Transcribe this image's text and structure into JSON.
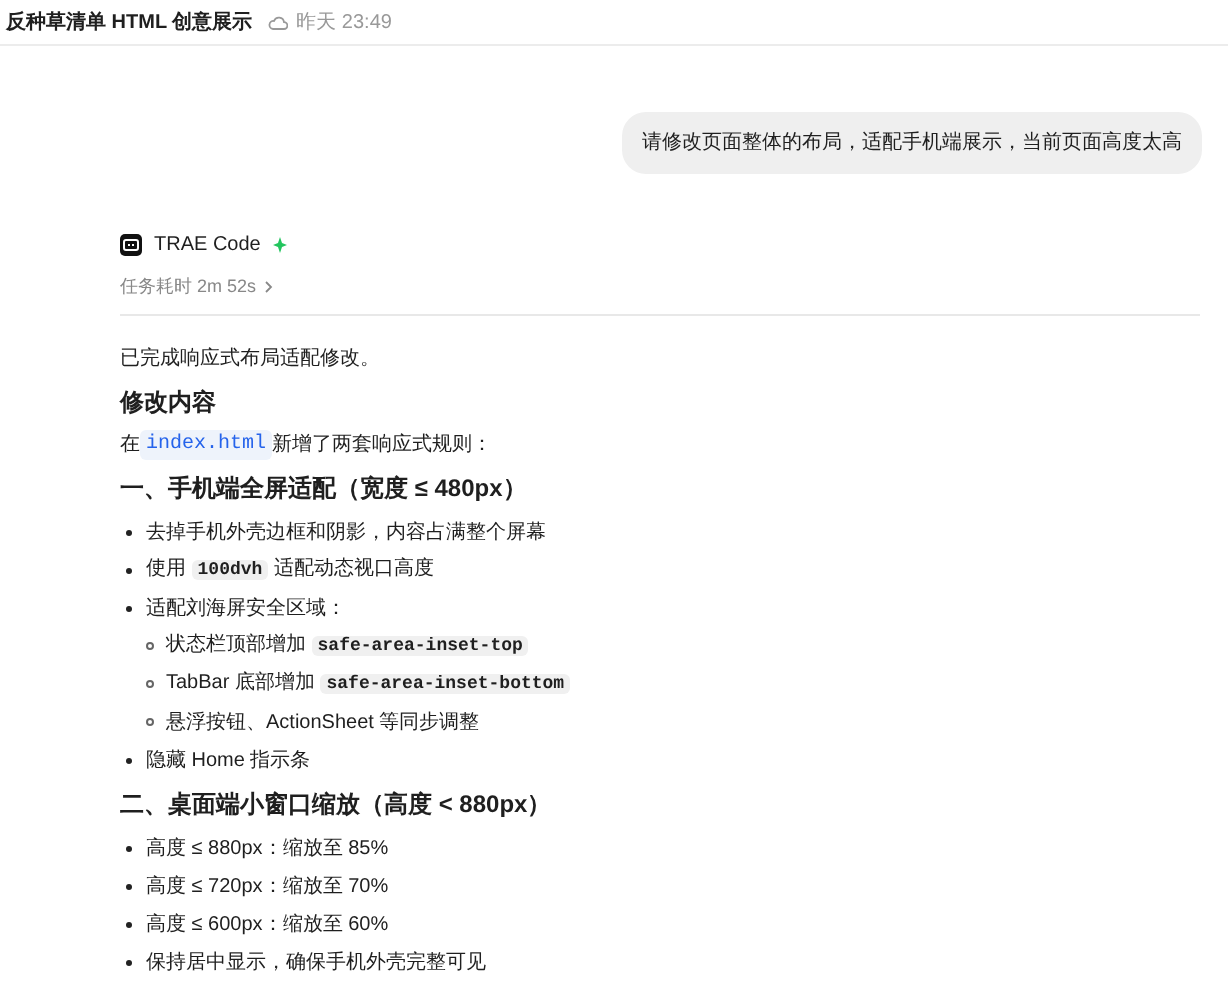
{
  "header": {
    "title": "反种草清单 HTML 创意展示",
    "time": "昨天 23:49"
  },
  "user_message": "请修改页面整体的布局，适配手机端展示，当前页面高度太高",
  "assistant": {
    "name": "TRAE Code",
    "duration": "任务耗时 2m 52s"
  },
  "content": [
    {
      "kind": "paragraph",
      "segments": [
        {
          "kind": "text",
          "text": "已完成响应式布局适配修改。"
        }
      ]
    },
    {
      "kind": "heading",
      "segments": [
        {
          "kind": "text",
          "text": "修改内容"
        }
      ]
    },
    {
      "kind": "paragraph",
      "segments": [
        {
          "kind": "text",
          "text": "在 "
        },
        {
          "kind": "file",
          "text": "index.html"
        },
        {
          "kind": "text",
          "text": " 新增了两套响应式规则："
        }
      ]
    },
    {
      "kind": "heading",
      "segments": [
        {
          "kind": "text",
          "text": "一、手机端全屏适配（宽度 ≤ 480px）"
        }
      ]
    },
    {
      "kind": "list",
      "items": [
        {
          "segments": [
            {
              "kind": "text",
              "text": "去掉手机外壳边框和阴影，内容占满整个屏幕"
            }
          ]
        },
        {
          "segments": [
            {
              "kind": "text",
              "text": "使用 "
            },
            {
              "kind": "code",
              "text": "100dvh"
            },
            {
              "kind": "text",
              "text": " 适配动态视口高度"
            }
          ]
        },
        {
          "segments": [
            {
              "kind": "text",
              "text": "适配刘海屏安全区域："
            }
          ],
          "children": [
            {
              "segments": [
                {
                  "kind": "text",
                  "text": "状态栏顶部增加 "
                },
                {
                  "kind": "code",
                  "text": "safe-area-inset-top"
                }
              ]
            },
            {
              "segments": [
                {
                  "kind": "text",
                  "text": "TabBar 底部增加 "
                },
                {
                  "kind": "code",
                  "text": "safe-area-inset-bottom"
                }
              ]
            },
            {
              "segments": [
                {
                  "kind": "text",
                  "text": "悬浮按钮、ActionSheet 等同步调整"
                }
              ]
            }
          ]
        },
        {
          "segments": [
            {
              "kind": "text",
              "text": "隐藏 Home 指示条"
            }
          ]
        }
      ]
    },
    {
      "kind": "heading",
      "segments": [
        {
          "kind": "text",
          "text": "二、桌面端小窗口缩放（高度 < 880px）"
        }
      ]
    },
    {
      "kind": "list",
      "items": [
        {
          "segments": [
            {
              "kind": "text",
              "text": "高度 ≤ 880px：缩放至 85%"
            }
          ]
        },
        {
          "segments": [
            {
              "kind": "text",
              "text": "高度 ≤ 720px：缩放至 70%"
            }
          ]
        },
        {
          "segments": [
            {
              "kind": "text",
              "text": "高度 ≤ 600px：缩放至 60%"
            }
          ]
        },
        {
          "segments": [
            {
              "kind": "text",
              "text": "保持居中显示，确保手机外壳完整可见"
            }
          ]
        }
      ]
    }
  ]
}
